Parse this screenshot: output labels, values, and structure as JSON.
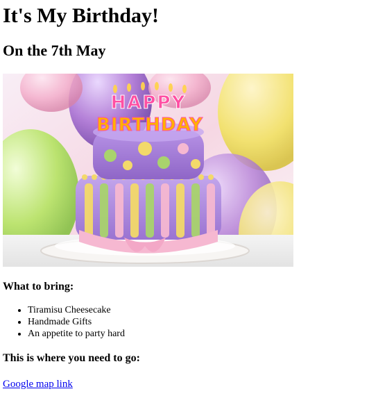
{
  "page": {
    "title": "It's My Birthday!",
    "date_heading": "On the 7th May"
  },
  "image": {
    "alt": "Birthday cake with Happy Birthday candles",
    "candles_line1": "HAPPY",
    "candles_line2": "BIRTHDAY",
    "colors": {
      "background_pink": "#f6d7e3",
      "balloon_purple": "#b07ad6",
      "balloon_yellow": "#f2e26a",
      "balloon_green": "#b9e46a",
      "balloon_pink": "#f3a8c7",
      "cake_purple": "#a67bd3",
      "cake_pink": "#f6b8d1",
      "cake_yellow": "#f3d96a",
      "cake_green": "#a9d36d",
      "plate": "#f3f1ef",
      "table": "#f0f0f0"
    }
  },
  "sections": {
    "bring_heading": "What to bring:",
    "bring_items": [
      "Tiramisu Cheesecake",
      "Handmade Gifts",
      "An appetite to party hard"
    ],
    "go_heading": "This is where you need to go:",
    "map_link_text": "Google map link"
  }
}
